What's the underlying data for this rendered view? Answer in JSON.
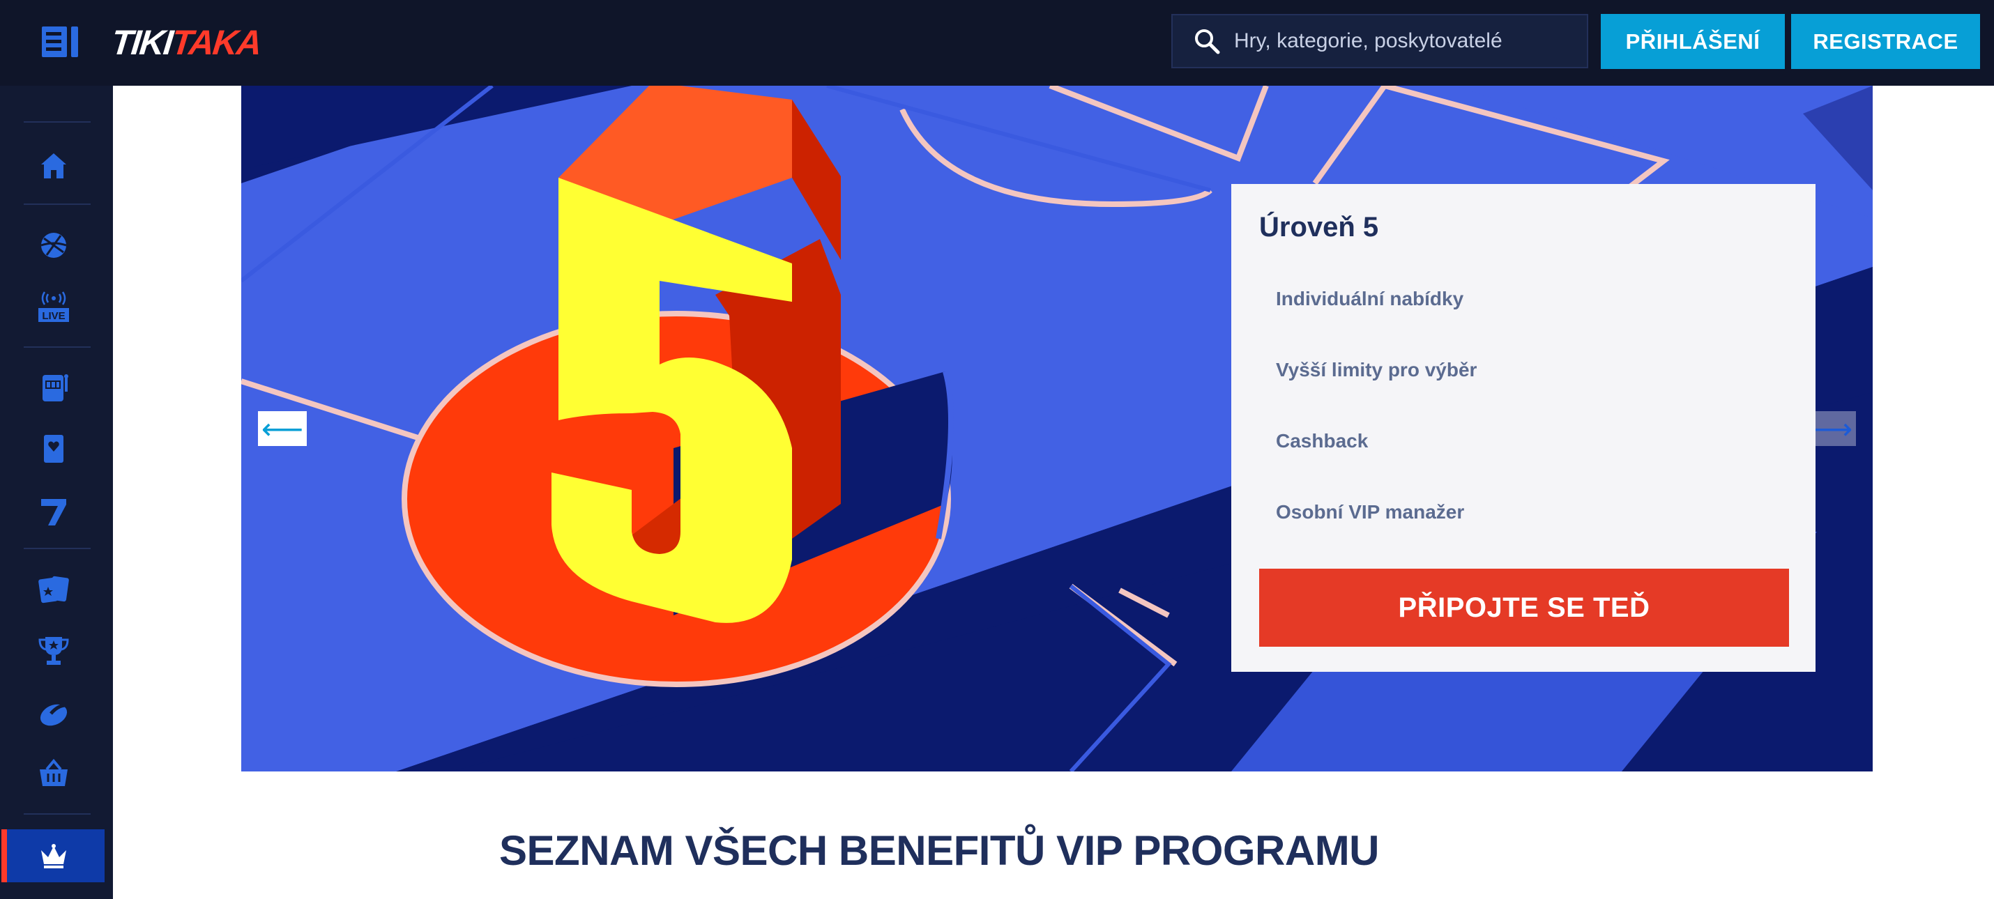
{
  "header": {
    "logo_part1": "TIKI",
    "logo_part2": "TAKA",
    "search_placeholder": "Hry, kategorie, poskytovatelé",
    "login_label": "PŘIHLÁŠENÍ",
    "register_label": "REGISTRACE"
  },
  "sidebar": {
    "live_label": "LIVE",
    "items": [
      {
        "icon": "dashboard-icon"
      },
      {
        "icon": "home-icon"
      },
      {
        "icon": "sports-ball-icon"
      },
      {
        "icon": "live-broadcast-icon"
      },
      {
        "icon": "slot-machine-icon"
      },
      {
        "icon": "playing-card-icon"
      },
      {
        "icon": "seven-icon"
      },
      {
        "icon": "cards-icon"
      },
      {
        "icon": "trophy-icon"
      },
      {
        "icon": "chip-icon"
      },
      {
        "icon": "shop-basket-icon"
      },
      {
        "icon": "vip-crown-icon"
      }
    ]
  },
  "banner": {
    "level_number": "5",
    "arrow_left": "⟵",
    "arrow_right": "⟶",
    "card": {
      "title": "Úroveň 5",
      "benefits": [
        "Individuální nabídky",
        "Vyšší limity pro výběr",
        "Cashback",
        "Osobní VIP manažer"
      ],
      "cta": "PŘIPOJTE SE TEĎ"
    }
  },
  "section_heading": "SEZNAM VŠECH BENEFITŮ VIP PROGRAMU",
  "colors": {
    "topbar_bg": "#0f1529",
    "sidebar_bg": "#121a33",
    "accent_blue": "#079fd6",
    "accent_red": "#e53a26",
    "heading": "#1f2f5c"
  }
}
